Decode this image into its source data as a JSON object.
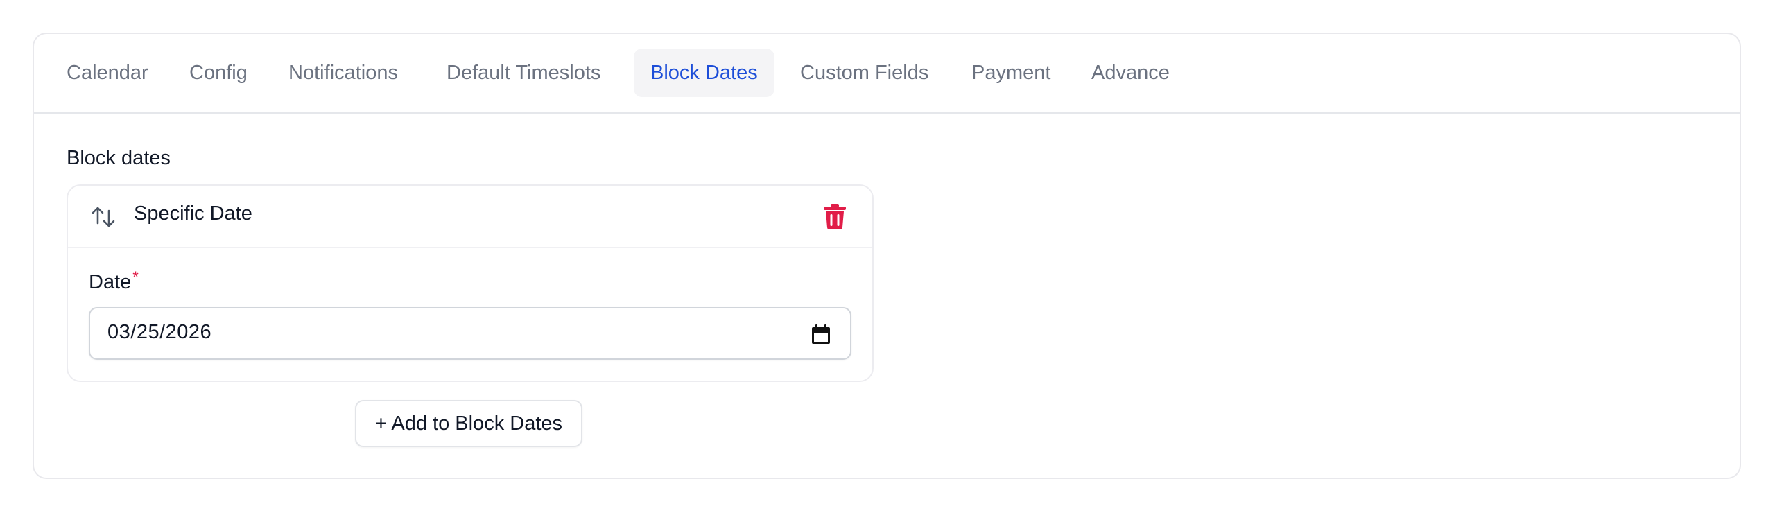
{
  "tabs": [
    {
      "label": "Calendar",
      "active": false
    },
    {
      "label": "Config",
      "active": false
    },
    {
      "label": "Notifications",
      "active": false
    },
    {
      "label": "Default Timeslots",
      "active": false
    },
    {
      "label": "Block Dates",
      "active": true
    },
    {
      "label": "Custom Fields",
      "active": false
    },
    {
      "label": "Payment",
      "active": false
    },
    {
      "label": "Advance",
      "active": false
    }
  ],
  "section": {
    "label": "Block dates"
  },
  "block_item": {
    "title": "Specific Date",
    "sort_icon": "sort-arrows-icon",
    "delete_icon": "trash-icon",
    "field": {
      "label": "Date",
      "required_mark": "*",
      "value": "03/25/2026",
      "icon": "calendar-icon"
    }
  },
  "add_button": {
    "label": "+ Add to Block Dates"
  },
  "colors": {
    "active_tab_text": "#1d4ed8",
    "active_tab_bg": "#f4f4f6",
    "inactive_tab_text": "#6b7280",
    "delete_icon": "#e11d48",
    "required_mark": "#e11d48"
  }
}
